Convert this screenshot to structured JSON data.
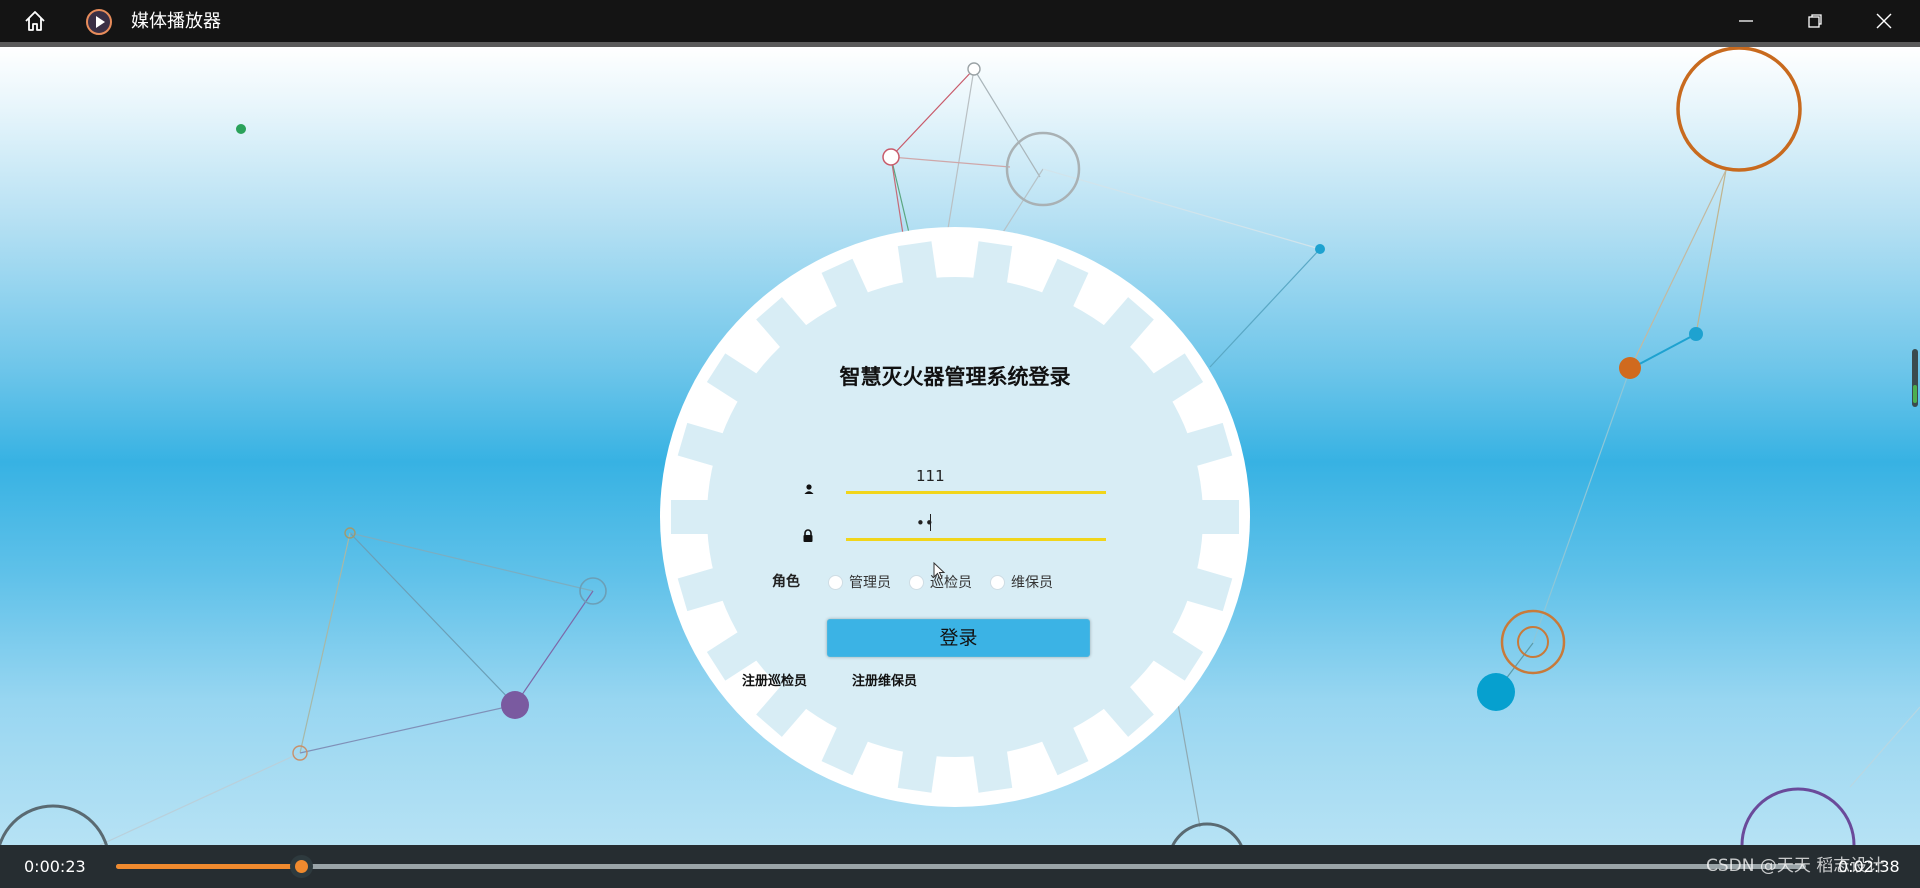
{
  "window": {
    "title": "媒体播放器",
    "icons": {
      "home": "home-icon",
      "logo": "play-logo-icon",
      "minimize": "minimize-icon",
      "maximize": "restore-icon",
      "close": "close-icon"
    }
  },
  "login": {
    "title": "智慧灭火器管理系统登录",
    "username_value": "111",
    "password_value": "••",
    "role_label": "角色",
    "roles": [
      "管理员",
      "巡检员",
      "维保员"
    ],
    "submit_label": "登录",
    "register_inspector": "注册巡检员",
    "register_maintainer": "注册维保员",
    "field_underline_color": "#f1d51a",
    "button_color": "#3bb3e5"
  },
  "player": {
    "current_time": "0:00:23",
    "total_time": "0:02:38",
    "progress_fraction": 0.11,
    "accent_color": "#f08a2e",
    "watermark": "CSDN @天天 稻志设计"
  }
}
